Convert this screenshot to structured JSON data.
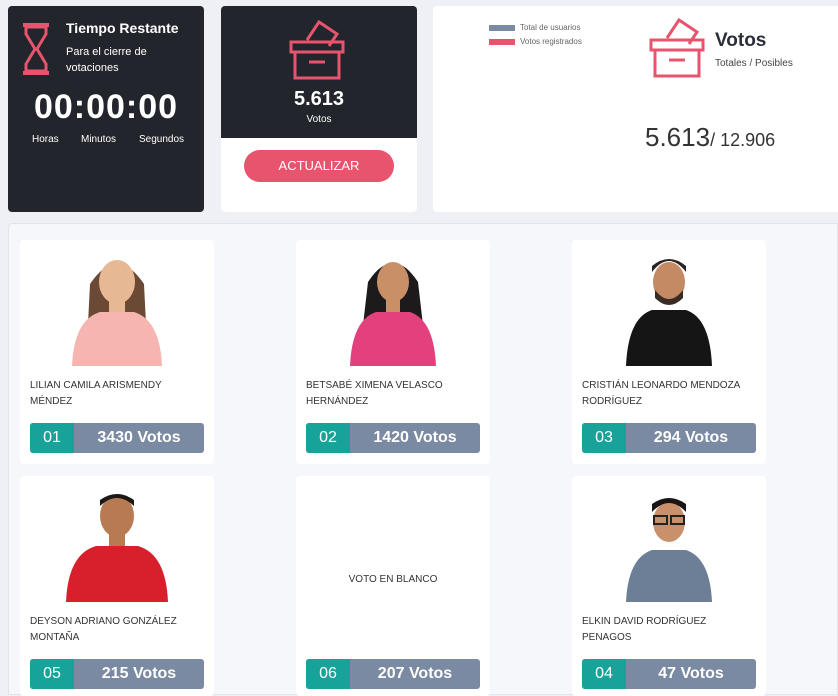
{
  "countdown": {
    "title": "Tiempo Restante",
    "subtitle": "Para el cierre de votaciones",
    "time": "00:00:00",
    "units": [
      "Horas",
      "Minutos",
      "Segundos"
    ]
  },
  "votes_card": {
    "count": "5.613",
    "label": "Votos",
    "update_button": "ACTUALIZAR"
  },
  "totals": {
    "legend": [
      {
        "label": "Total de usuarios",
        "color": "#7b8aa3"
      },
      {
        "label": "Votos registrados",
        "color": "#e8546d"
      }
    ],
    "title": "Votos",
    "subtitle": "Totales / Posibles",
    "registered": "5.613",
    "possible": "/ 12.906"
  },
  "candidates": [
    {
      "number": "01",
      "name": "LILIAN CAMILA ARISMENDY MÉNDEZ",
      "votes": "3430 Votos"
    },
    {
      "number": "02",
      "name": "BETSABÉ XIMENA VELASCO HERNÁNDEZ",
      "votes": "1420 Votos"
    },
    {
      "number": "03",
      "name": "CRISTIÁN LEONARDO MENDOZA RODRÍGUEZ",
      "votes": "294 Votos"
    },
    {
      "number": "05",
      "name": "DEYSON ADRIANO GONZÁLEZ MONTAÑA",
      "votes": "215 Votos"
    },
    {
      "number": "06",
      "name": "VOTO EN BLANCO",
      "votes": "207 Votos"
    },
    {
      "number": "04",
      "name": "ELKIN DAVID RODRÍGUEZ PENAGOS",
      "votes": "47 Votos"
    }
  ],
  "colors": {
    "accent_red": "#e8546d",
    "teal": "#17a39a",
    "slate": "#7b8aa3",
    "dark": "#22252b"
  }
}
